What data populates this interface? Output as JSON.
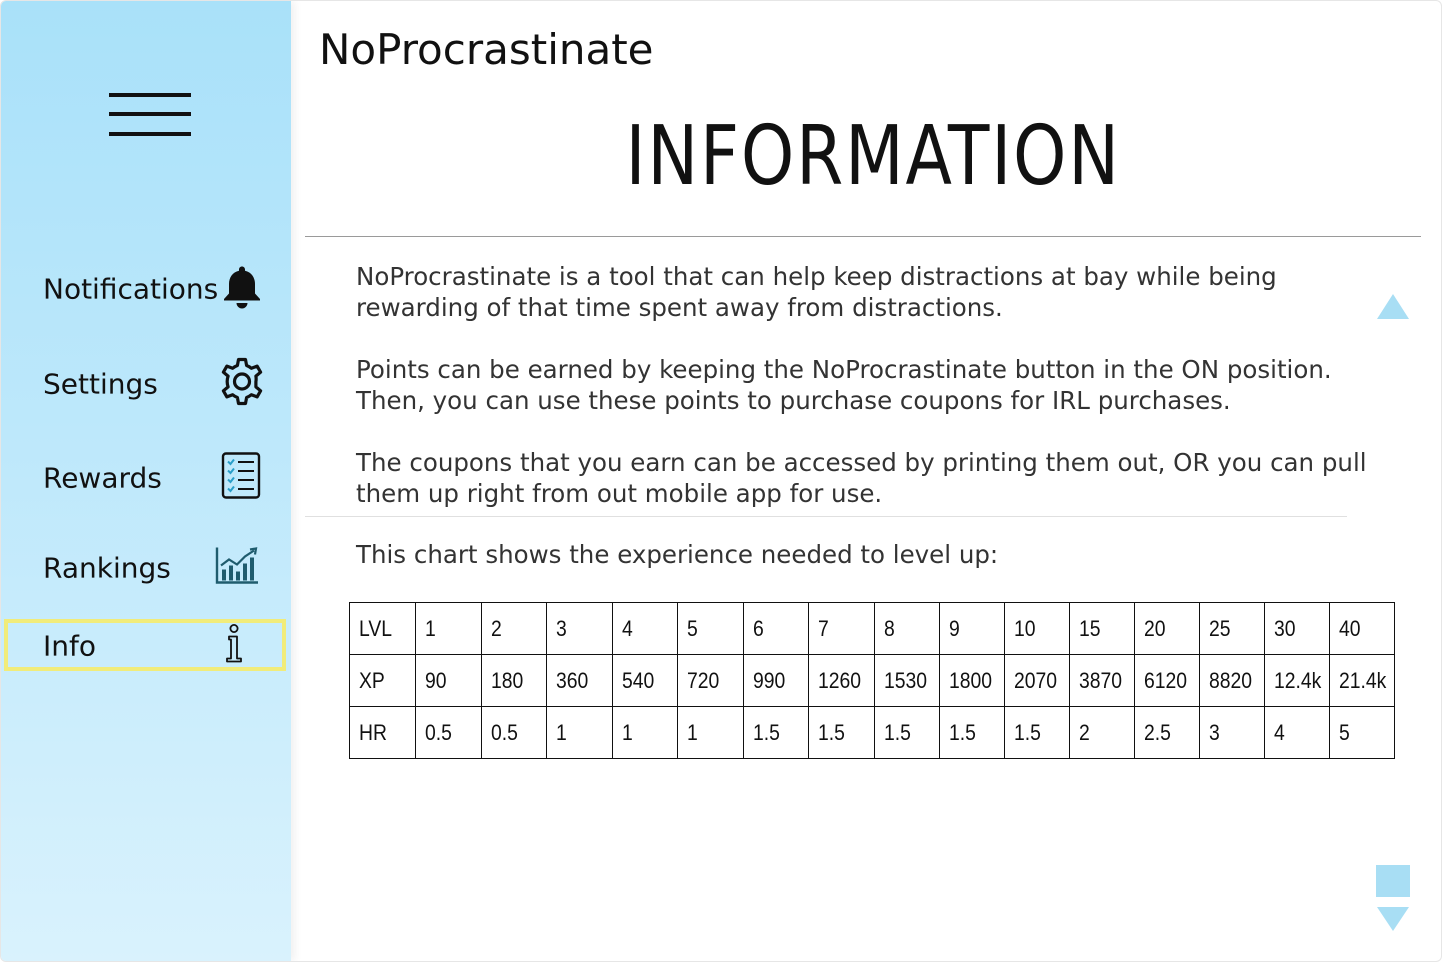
{
  "app": {
    "title": "NoProcrastinate"
  },
  "sidebar": {
    "items": [
      {
        "label": "Notifications",
        "icon": "bell-icon"
      },
      {
        "label": "Settings",
        "icon": "gear-icon"
      },
      {
        "label": "Rewards",
        "icon": "checklist-icon"
      },
      {
        "label": "Rankings",
        "icon": "chart-icon"
      },
      {
        "label": "Info",
        "icon": "info-icon",
        "active": true
      }
    ]
  },
  "main": {
    "heading": "INFORMATION",
    "paragraphs": [
      [
        "NoProcrastinate is a tool that can help keep distractions at bay while being",
        "rewarding of that time spent away from distractions."
      ],
      [
        "Points can be earned by keeping the NoProcrastinate button in the ON position.",
        "Then, you can use these points to purchase coupons for IRL purchases."
      ],
      [
        "The coupons that you earn can be accessed by printing them out, OR you can pull",
        "them up right from out mobile app for use."
      ]
    ],
    "chart_intro": "This chart shows the experience needed to level up:"
  },
  "table": {
    "rows": [
      {
        "header": "LVL",
        "cells": [
          "1",
          "2",
          "3",
          "4",
          "5",
          "6",
          "7",
          "8",
          "9",
          "10",
          "15",
          "20",
          "25",
          "30",
          "40"
        ]
      },
      {
        "header": "XP",
        "cells": [
          "90",
          "180",
          "360",
          "540",
          "720",
          "990",
          "1260",
          "1530",
          "1800",
          "2070",
          "3870",
          "6120",
          "8820",
          "12.4k",
          "21.4k"
        ]
      },
      {
        "header": "HR",
        "cells": [
          "0.5",
          "0.5",
          "1",
          "1",
          "1",
          "1.5",
          "1.5",
          "1.5",
          "1.5",
          "1.5",
          "2",
          "2.5",
          "3",
          "4",
          "5"
        ]
      }
    ]
  },
  "colors": {
    "sidebar_top": "#a9e1f9",
    "sidebar_bottom": "#d9f2fd",
    "highlight": "#f1ec7a",
    "scroll_accent": "#a8def4",
    "chart_icon": "#1f5c6e"
  }
}
